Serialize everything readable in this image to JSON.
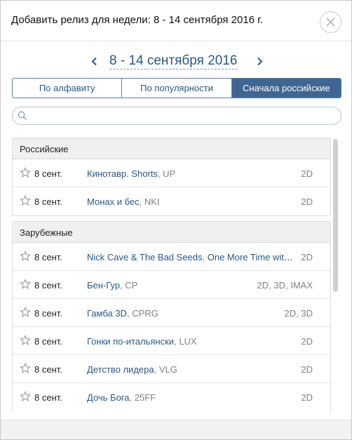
{
  "dialog": {
    "title": "Добавить релиз для недели: 8 - 14 сентября 2016 г.",
    "close_icon": "close-icon"
  },
  "week_nav": {
    "prev_icon": "chevron-left-icon",
    "label": "8 - 14 сентября 2016",
    "next_icon": "chevron-right-icon"
  },
  "sort_tabs": [
    {
      "label": "По алфавиту",
      "active": false
    },
    {
      "label": "По популярности",
      "active": false
    },
    {
      "label": "Сначала российские",
      "active": true
    }
  ],
  "search": {
    "icon": "search-icon",
    "value": "",
    "placeholder": ""
  },
  "groups": [
    {
      "name": "Российские",
      "items": [
        {
          "date": "8 сент.",
          "title": "Кинотавр. Shorts",
          "distributor": "UP",
          "format": "2D"
        },
        {
          "date": "8 сент.",
          "title": "Монах и бес",
          "distributor": "NKI",
          "format": "2D"
        }
      ]
    },
    {
      "name": "Зарубежные",
      "items": [
        {
          "date": "8 сент.",
          "title": "Nick Cave & The Bad Seeds. One More Time with Feeling",
          "distributor": "",
          "format": "2D"
        },
        {
          "date": "8 сент.",
          "title": "Бен-Гур",
          "distributor": "CP",
          "format": "2D, 3D, IMAX"
        },
        {
          "date": "8 сент.",
          "title": "Гамба 3D",
          "distributor": "CPRG",
          "format": "2D, 3D"
        },
        {
          "date": "8 сент.",
          "title": "Гонки по-итальянски",
          "distributor": "LUX",
          "format": "2D"
        },
        {
          "date": "8 сент.",
          "title": "Детство лидера",
          "distributor": "VLG",
          "format": "2D"
        },
        {
          "date": "8 сент.",
          "title": "Дочь Бога",
          "distributor": "25FF",
          "format": "2D"
        }
      ]
    }
  ],
  "colors": {
    "accent": "#2a5885",
    "active_tab": "#3f6690",
    "muted_text": "#828282",
    "group_header_bg": "#f0f0f0"
  }
}
